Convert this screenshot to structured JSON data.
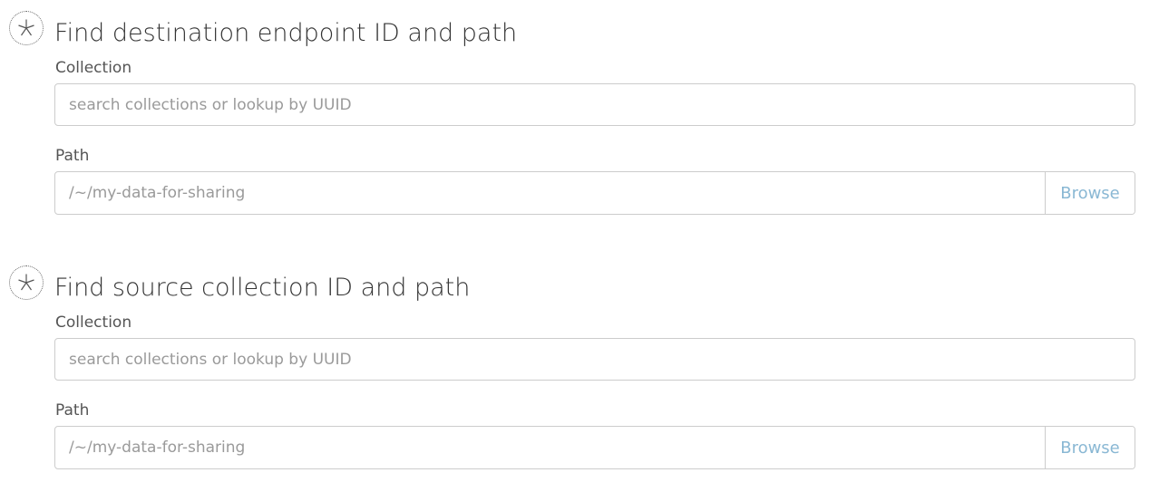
{
  "sections": [
    {
      "title": "Find destination endpoint ID and path",
      "icon": "asterisk-icon",
      "collection": {
        "label": "Collection",
        "placeholder": "search collections or lookup by UUID"
      },
      "path": {
        "label": "Path",
        "placeholder": "/~/my-data-for-sharing",
        "browse_label": "Browse"
      }
    },
    {
      "title": "Find source collection ID and path",
      "icon": "asterisk-icon",
      "collection": {
        "label": "Collection",
        "placeholder": "search collections or lookup by UUID"
      },
      "path": {
        "label": "Path",
        "placeholder": "/~/my-data-for-sharing",
        "browse_label": "Browse"
      }
    }
  ],
  "colors": {
    "text": "#333333",
    "label": "#555555",
    "placeholder": "#9a9a9a",
    "border": "#cccccc",
    "browse_link": "#8ab8d4"
  }
}
